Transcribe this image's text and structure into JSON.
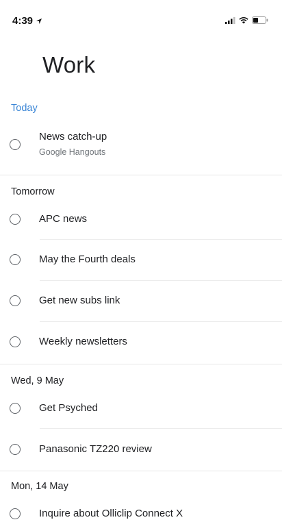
{
  "status_bar": {
    "time": "4:39"
  },
  "list": {
    "title": "Work"
  },
  "sections": [
    {
      "header": "Today",
      "tasks": [
        {
          "title": "News catch-up",
          "subtitle": "Google Hangouts"
        }
      ]
    },
    {
      "header": "Tomorrow",
      "tasks": [
        {
          "title": "APC news"
        },
        {
          "title": "May the Fourth deals"
        },
        {
          "title": "Get new subs link"
        },
        {
          "title": "Weekly newsletters"
        }
      ]
    },
    {
      "header": "Wed, 9 May",
      "tasks": [
        {
          "title": "Get Psyched"
        },
        {
          "title": "Panasonic TZ220 review"
        }
      ]
    },
    {
      "header": "Mon, 14 May",
      "tasks": [
        {
          "title": "Inquire about Olliclip Connect X"
        }
      ]
    }
  ],
  "colors": {
    "accent": "#3b86d6",
    "text": "#202124",
    "secondary_text": "#70757a"
  }
}
